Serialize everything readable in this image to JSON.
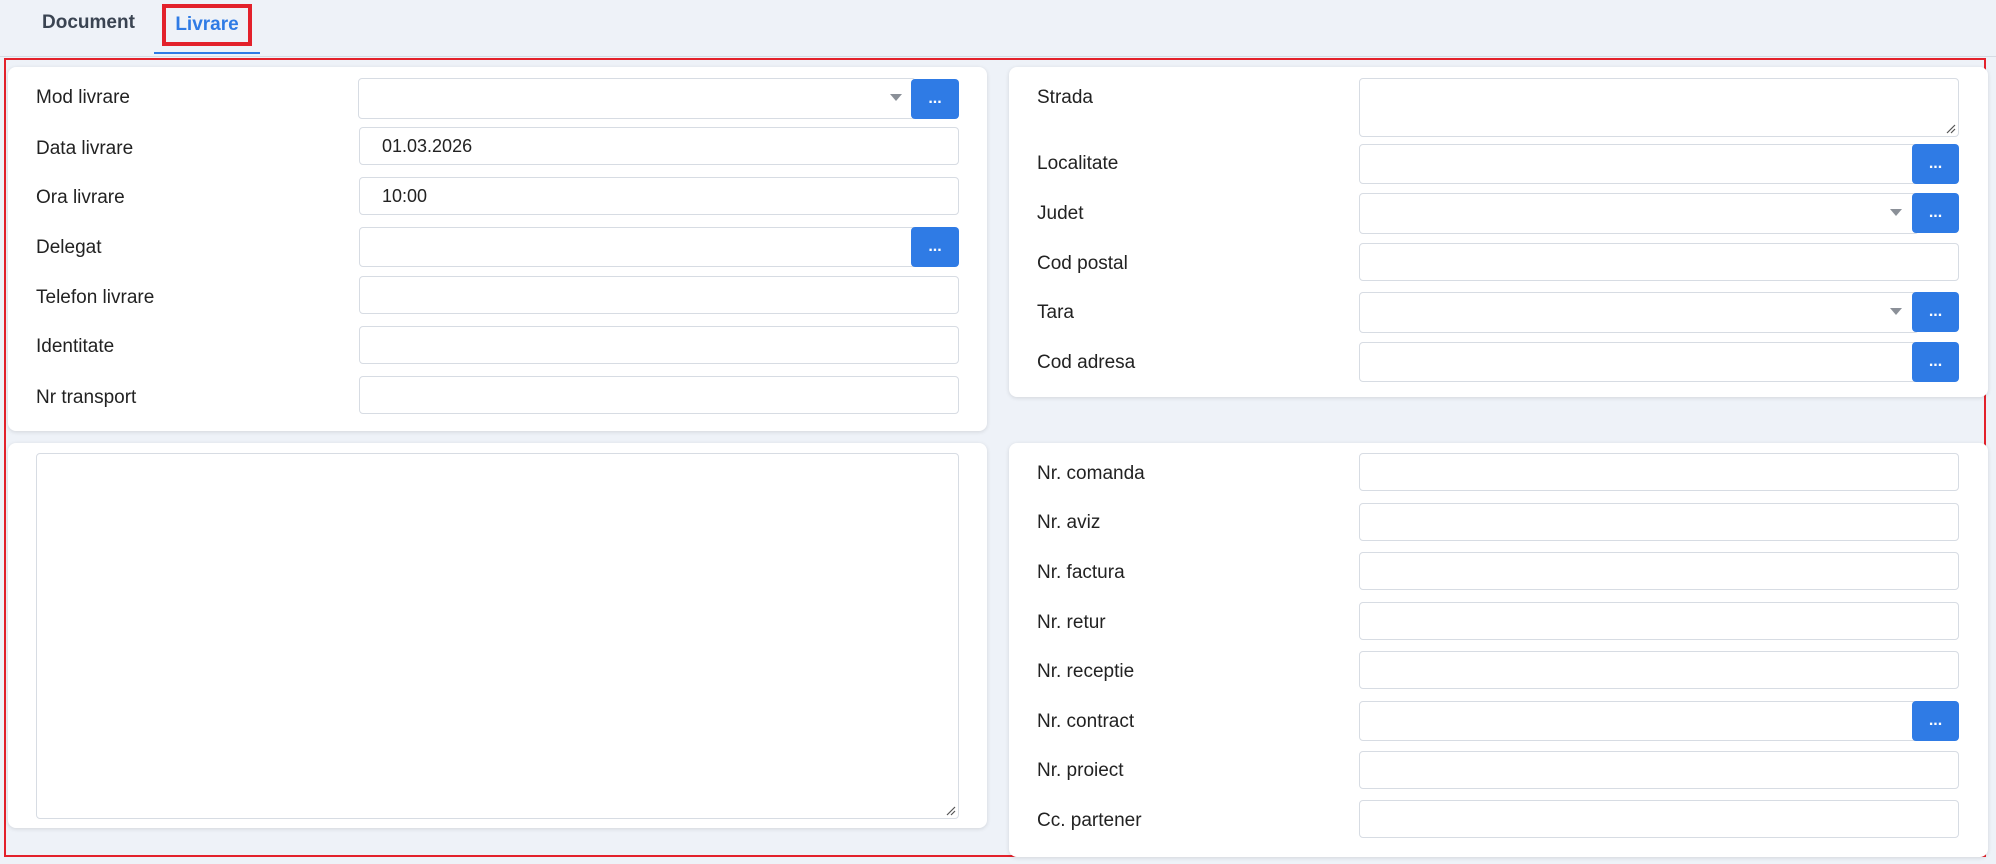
{
  "tabs": {
    "document": "Document",
    "livrare": "Livrare"
  },
  "delivery": {
    "mod_livrare": {
      "label": "Mod livrare",
      "value": ""
    },
    "data_livrare": {
      "label": "Data livrare",
      "value": "01.03.2026"
    },
    "ora_livrare": {
      "label": "Ora livrare",
      "value": "10:00"
    },
    "delegat": {
      "label": "Delegat",
      "value": ""
    },
    "telefon_livrare": {
      "label": "Telefon livrare",
      "value": ""
    },
    "identitate": {
      "label": "Identitate",
      "value": ""
    },
    "nr_transport": {
      "label": "Nr transport",
      "value": ""
    }
  },
  "address": {
    "strada": {
      "label": "Strada",
      "value": ""
    },
    "localitate": {
      "label": "Localitate",
      "value": ""
    },
    "judet": {
      "label": "Judet",
      "value": ""
    },
    "cod_postal": {
      "label": "Cod postal",
      "value": ""
    },
    "tara": {
      "label": "Tara",
      "value": ""
    },
    "cod_adresa": {
      "label": "Cod adresa",
      "value": ""
    }
  },
  "references": {
    "nr_comanda": {
      "label": "Nr. comanda",
      "value": ""
    },
    "nr_aviz": {
      "label": "Nr. aviz",
      "value": ""
    },
    "nr_factura": {
      "label": "Nr. factura",
      "value": ""
    },
    "nr_retur": {
      "label": "Nr. retur",
      "value": ""
    },
    "nr_receptie": {
      "label": "Nr. receptie",
      "value": ""
    },
    "nr_contract": {
      "label": "Nr. contract",
      "value": ""
    },
    "nr_proiect": {
      "label": "Nr. proiect",
      "value": ""
    },
    "cc_partener": {
      "label": "Cc. partener",
      "value": ""
    }
  },
  "lookup_button_label": "...",
  "notes": {
    "value": ""
  },
  "colors": {
    "accent": "#2f7be5",
    "highlight": "#e3212b",
    "background": "#eef2f8"
  }
}
